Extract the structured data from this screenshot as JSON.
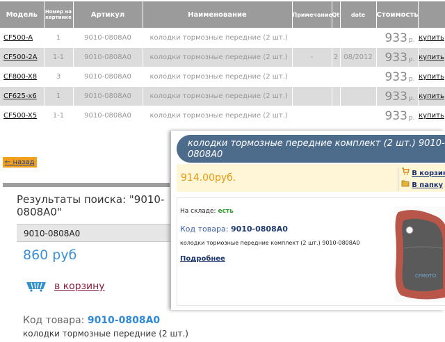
{
  "table": {
    "headers": {
      "model": "Модель",
      "num": "Номер на картинке",
      "article": "Артикул",
      "name": "Наименование",
      "note": "Примечание",
      "qty": "Qty",
      "date": "date",
      "price": "Стоимость"
    },
    "rows": [
      {
        "model": "CF500-A",
        "num": "1",
        "article": "9010-0808A0",
        "name": "колодки тормозные передние (2 шт.)",
        "note": "",
        "qty": "",
        "date": "",
        "price": "933",
        "currency": "р.",
        "buy": "купить"
      },
      {
        "model": "CF500-2A",
        "num": "1-1",
        "article": "9010-0808A0",
        "name": "колодки тормозные передние (2 шт.)",
        "note": "-",
        "qty": "2",
        "date": "08/2012",
        "price": "933",
        "currency": "р.",
        "buy": "купить"
      },
      {
        "model": "CF800-X8",
        "num": "3",
        "article": "9010-0808A0",
        "name": "колодки тормозные передние (2 шт.)",
        "note": "",
        "qty": "",
        "date": "",
        "price": "933",
        "currency": "р.",
        "buy": "купить"
      },
      {
        "model": "CF625-x6",
        "num": "1",
        "article": "9010-0808A0",
        "name": "колодки тормозные передние (2 шт.)",
        "note": "",
        "qty": "",
        "date": "",
        "price": "933",
        "currency": "р.",
        "buy": "купить"
      },
      {
        "model": "CF500-X5",
        "num": "1-1",
        "article": "9010-0808A0",
        "name": "колодки тормозные передние (2 шт.)",
        "note": "",
        "qty": "",
        "date": "",
        "price": "933",
        "currency": "р.",
        "buy": "купить"
      }
    ]
  },
  "left": {
    "back_label": "← назад",
    "results_title": "Результаты поиска: \"9010-0808A0\"",
    "code_box": "9010-0808A0",
    "price": "860 руб",
    "cart_label": "в корзину",
    "code_label": "Код товара:",
    "code_value": "9010-0808A0",
    "description": "колодки тормозные передние (2 шт.)"
  },
  "panel": {
    "title": "колодки тормозные передние комплект (2 шт.) 9010-0808A0",
    "price": "914.00руб.",
    "to_cart": "В корзин",
    "to_folder": "В папку",
    "stock_label": "На складе:",
    "stock_value": "есть",
    "code_label": "Код товара:",
    "code_value": "9010-0808A0",
    "description": "колодки тормозные передние комплект (2 шт.) 9010-0808A0",
    "more_link": "Подробнее",
    "image_watermark": "CFMOTO"
  },
  "colors": {
    "header_bg": "#9b9b9b",
    "row_alt": "#dcdcdc",
    "accent_blue": "#3b8fd6",
    "cart_red": "#8a1e3e",
    "back_orange": "#f0a01a",
    "banner_blue": "#4d6b8a",
    "price_orange": "#e69a10"
  }
}
